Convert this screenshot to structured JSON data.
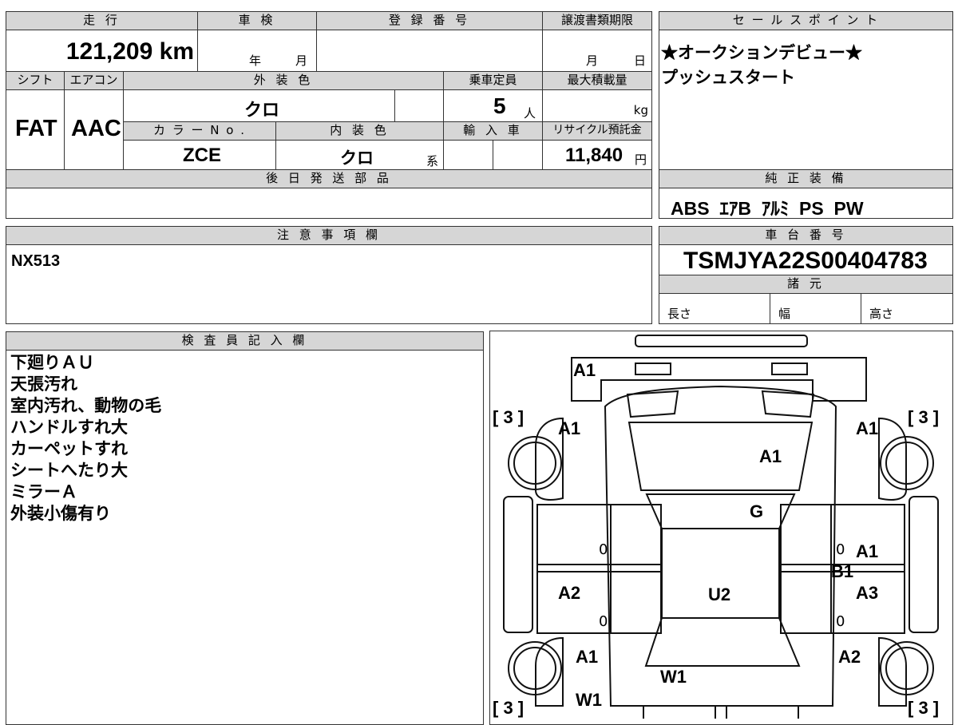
{
  "header": {
    "mileage_label": "走 行",
    "inspection_label": "車 検",
    "registration_label": "登 録 番 号",
    "transfer_deadline_label": "譲渡書類期限",
    "sales_points_label": "セ ー ル ス ポ イ ン ト",
    "mileage_value": "121,209 km",
    "inspection_year": "年",
    "inspection_month": "月",
    "registration_value": "",
    "transfer_month": "月",
    "transfer_day": "日"
  },
  "sales_points": {
    "line1": "★オークションデビュー★",
    "line2": "プッシュスタート"
  },
  "specs": {
    "shift_label": "シフト",
    "ac_label": "エアコン",
    "exterior_color_label": "外 装 色",
    "capacity_label": "乗車定員",
    "max_load_label": "最大積載量",
    "shift_value": "FAT",
    "ac_value": "AAC",
    "exterior_color_value": "クロ",
    "capacity_value": "5",
    "capacity_unit": "人",
    "max_load_unit": "kg",
    "color_no_label": "カ ラ ー N o .",
    "interior_color_label": "内 装 色",
    "import_label": "輸 入 車",
    "recycle_fee_label": "リサイクル預託金",
    "color_no_value": "ZCE",
    "interior_color_value": "クロ",
    "interior_color_suffix": "系",
    "recycle_fee_value": "11,840",
    "recycle_fee_unit": "円"
  },
  "later_parts": {
    "label": "後 日 発 送 部 品",
    "value": ""
  },
  "standard_equipment": {
    "label": "純 正 装 備",
    "value": "ABS  ｴｱB  ｱﾙﾐ  PS  PW"
  },
  "cautions": {
    "label": "注 意 事 項 欄",
    "value": "NX513"
  },
  "chassis": {
    "label": "車 台 番 号",
    "value": "TSMJYA22S00404783",
    "specs_label": "諸 元",
    "length_label": "長さ",
    "width_label": "幅",
    "height_label": "高さ"
  },
  "inspector": {
    "label": "検 査 員 記 入 欄",
    "notes": [
      "下廻りＡＵ",
      "天張汚れ",
      "室内汚れ、動物の毛",
      "ハンドルすれ大",
      "カーペットすれ",
      "シートへたり大",
      "ミラーＡ",
      "外装小傷有り"
    ]
  },
  "diagram": {
    "marks": {
      "front_bumper": "A1",
      "front_left_fender": "A1",
      "front_right_fender": "A1",
      "hood": "A1",
      "windshield": "G",
      "right_front_door": "A1",
      "right_front_door_b": "B1",
      "left_rear_door": "A2",
      "roof": "U2",
      "right_rear_door": "A3",
      "left_rear_fender": "A1",
      "right_rear_fender": "A2",
      "rear_glass": "W1",
      "left_rear_glass": "W1"
    },
    "tire_front_left": "[ 3 ]",
    "tire_front_right": "[ 3 ]",
    "tire_rear_left": "[ 3 ]",
    "tire_rear_right": "[ 3 ]",
    "pillar_marks": [
      "0",
      "0",
      "0",
      "0"
    ]
  }
}
